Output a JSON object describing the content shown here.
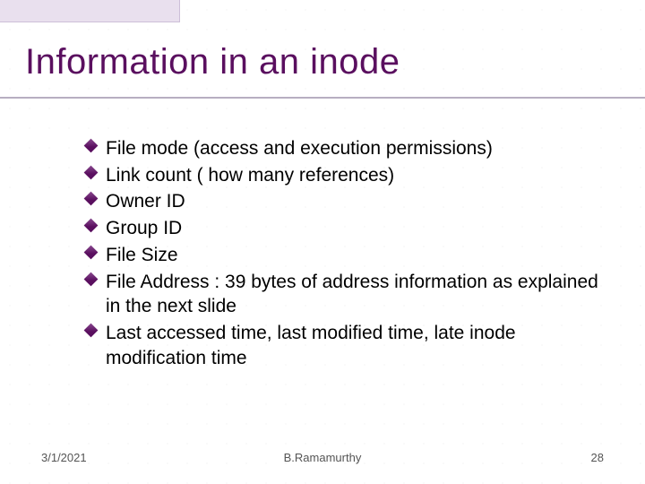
{
  "title": "Information in an inode",
  "bullets": [
    "File mode (access and execution permissions)",
    "Link count ( how many references)",
    "Owner ID",
    "Group ID",
    "File Size",
    "File Address : 39 bytes of address information as explained in the next slide",
    "Last accessed time, last modified time, late inode modification time"
  ],
  "footer": {
    "date": "3/1/2021",
    "author": "B.Ramamurthy",
    "page": "28"
  }
}
